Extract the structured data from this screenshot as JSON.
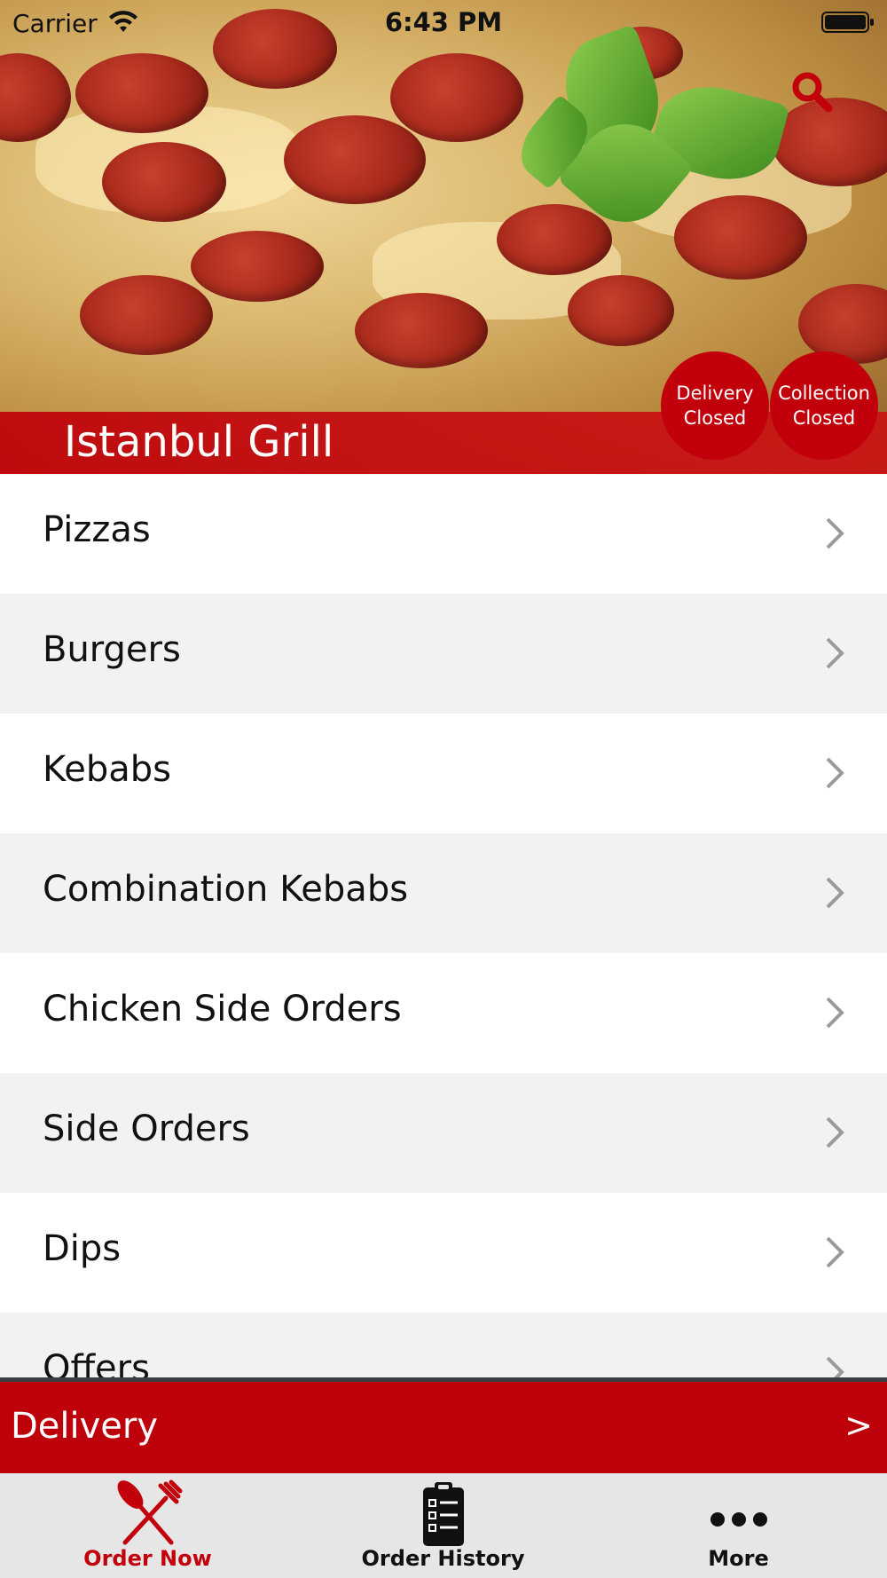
{
  "status_bar": {
    "carrier": "Carrier",
    "time": "6:43 PM"
  },
  "hero": {
    "restaurant_name": "Istanbul Grill",
    "search_icon": "search-icon",
    "badges": {
      "delivery": {
        "line1": "Delivery",
        "line2": "Closed"
      },
      "collection": {
        "line1": "Collection",
        "line2": "Closed"
      }
    }
  },
  "categories": [
    {
      "label": "Pizzas"
    },
    {
      "label": "Burgers"
    },
    {
      "label": "Kebabs"
    },
    {
      "label": "Combination Kebabs"
    },
    {
      "label": "Chicken Side Orders"
    },
    {
      "label": "Side Orders"
    },
    {
      "label": "Dips"
    },
    {
      "label": "Offers"
    }
  ],
  "delivery_bar": {
    "label": "Delivery",
    "arrow": ">"
  },
  "tabs": [
    {
      "label": "Order Now",
      "icon": "fork-knife-icon",
      "active": true
    },
    {
      "label": "Order History",
      "icon": "clipboard-icon",
      "active": false
    },
    {
      "label": "More",
      "icon": "more-dots-icon",
      "active": false
    }
  ],
  "colors": {
    "brand_red": "#c2000b",
    "row_alt": "#f1f2f4",
    "tab_bar": "#e6e6e6"
  }
}
